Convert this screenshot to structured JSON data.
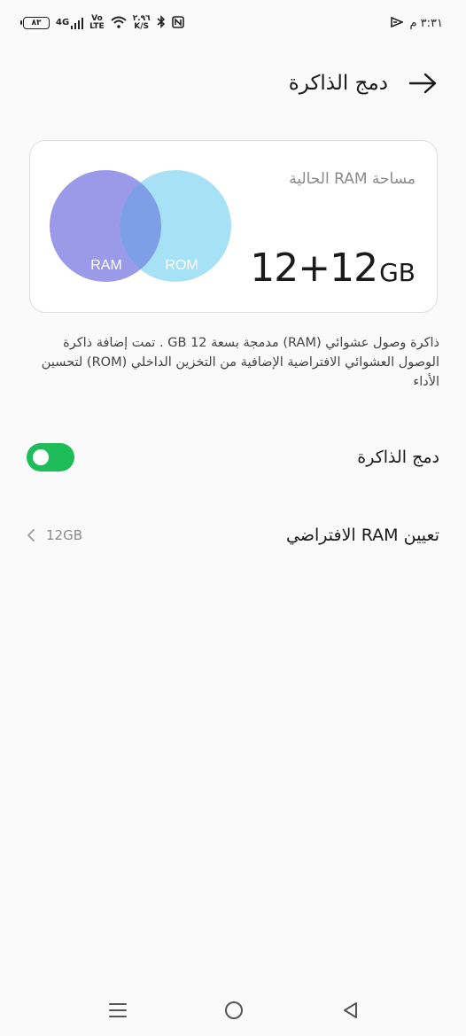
{
  "status_bar": {
    "time": "٣:٣١ م",
    "battery": "٨٣",
    "network": "4G",
    "volte_top": "Vo",
    "volte_bottom": "LTE",
    "speed_value": "٢.٩٦",
    "speed_unit": "K/S",
    "icons": [
      "battery-icon",
      "signal-icon",
      "volte-icon",
      "wifi-icon",
      "bluetooth-icon",
      "nfc-icon",
      "notification-icon"
    ]
  },
  "header": {
    "title": "دمج الذاكرة",
    "back_icon": "arrow-right-icon"
  },
  "card": {
    "label": "مساحة RAM الحالية",
    "capacity_value": "12+12",
    "capacity_unit": "GB",
    "venn": {
      "left_label": "RAM",
      "right_label": "ROM",
      "left_color": "#9a9ae8",
      "right_color": "#a6e1f5",
      "overlap_color": "#7e9ee8"
    }
  },
  "description": "ذاكرة وصول عشوائي (RAM) مدمجة بسعة 12 GB . تمت إضافة ذاكرة الوصول العشوائي الافتراضية الإضافية من التخزين الداخلي (ROM) لتحسين الأداء",
  "rows": {
    "memory_merge": {
      "label": "دمج الذاكرة",
      "enabled": true,
      "toggle_color": "#1fbd5a"
    },
    "virtual_ram": {
      "label": "تعيين RAM الافتراضي",
      "value": "12GB",
      "icon": "chevron-left-icon"
    }
  },
  "nav": {
    "icons": [
      "menu-icon",
      "home-icon",
      "back-icon"
    ]
  }
}
